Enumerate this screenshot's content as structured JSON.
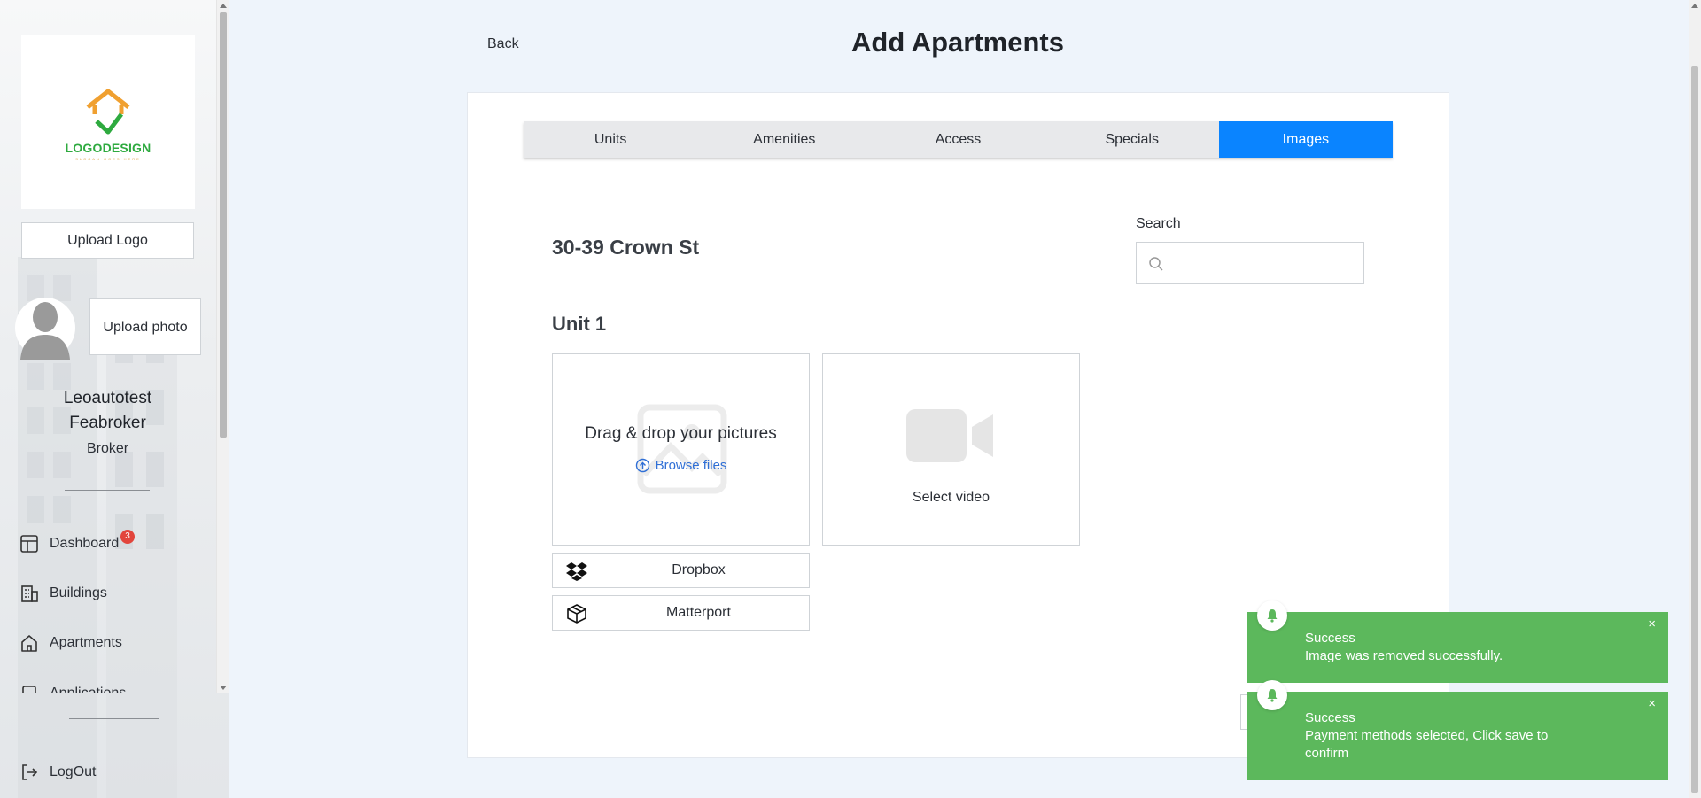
{
  "sidebar": {
    "logo_text": "LOGODESIGN",
    "logo_subtext": "SLOGAN GOES HERE",
    "upload_logo_label": "Upload Logo",
    "upload_photo_label": "Upload photo",
    "user_first": "Leoautotest",
    "user_last": "Feabroker",
    "user_role": "Broker",
    "nav": [
      {
        "label": "Dashboard",
        "icon": "dashboard-icon"
      },
      {
        "label": "Buildings",
        "icon": "buildings-icon"
      },
      {
        "label": "Apartments",
        "icon": "home-icon"
      },
      {
        "label": "Applications",
        "icon": "applications-icon"
      }
    ],
    "dashboard_badge": "3",
    "logout_label": "LogOut"
  },
  "header": {
    "back_label": "Back",
    "title": "Add Apartments"
  },
  "tabs": [
    {
      "label": "Units",
      "active": false
    },
    {
      "label": "Amenities",
      "active": false
    },
    {
      "label": "Access",
      "active": false
    },
    {
      "label": "Specials",
      "active": false
    },
    {
      "label": "Images",
      "active": true
    }
  ],
  "content": {
    "building_name": "30-39 Crown St",
    "search_label": "Search",
    "search_value": "",
    "unit_title": "Unit 1",
    "drop_text": "Drag & drop your pictures",
    "browse_label": "Browse files",
    "video_label": "Select video",
    "dropbox_label": "Dropbox",
    "matterport_label": "Matterport"
  },
  "toasts": [
    {
      "title": "Success",
      "message": "Image was removed successfully.",
      "close": "×"
    },
    {
      "title": "Success",
      "message": "Payment methods selected, Click save to confirm",
      "close": "×"
    }
  ],
  "colors": {
    "accent": "#0a84ff",
    "toast_success": "#5cb85c",
    "badge": "#e2453c",
    "link": "#2f6fd6"
  }
}
